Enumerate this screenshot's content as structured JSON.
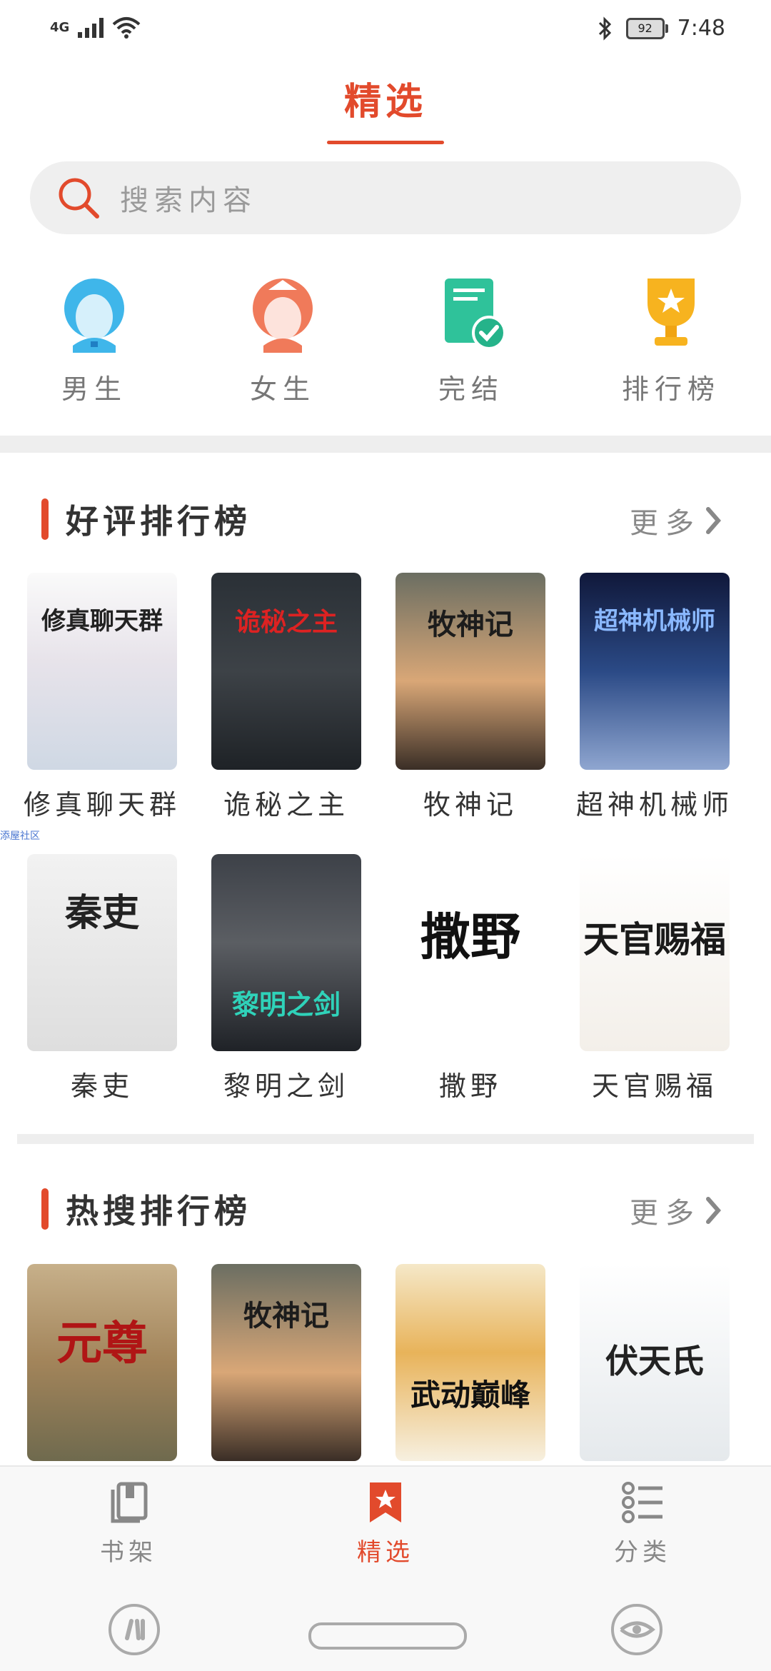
{
  "status": {
    "network": "4G",
    "battery": "92",
    "time": "7:48"
  },
  "header": {
    "title": "精选"
  },
  "search": {
    "placeholder": "搜索内容"
  },
  "quick": [
    {
      "label": "男生",
      "icon": "boy-avatar-icon"
    },
    {
      "label": "女生",
      "icon": "girl-avatar-icon"
    },
    {
      "label": "完结",
      "icon": "completed-book-icon"
    },
    {
      "label": "排行榜",
      "icon": "trophy-icon"
    }
  ],
  "section1": {
    "title": "好评排行榜",
    "more": "更多",
    "books": [
      {
        "title": "修真聊天群",
        "cover_text": "修真聊天群"
      },
      {
        "title": "诡秘之主",
        "cover_text": "诡秘之主"
      },
      {
        "title": "牧神记",
        "cover_text": "牧神记"
      },
      {
        "title": "超神机械师",
        "cover_text": "超神机械师"
      },
      {
        "title": "秦吏",
        "cover_text": "秦吏"
      },
      {
        "title": "黎明之剑",
        "cover_text": "黎明之剑"
      },
      {
        "title": "撒野",
        "cover_text": "撒野"
      },
      {
        "title": "天官赐福",
        "cover_text": "天官赐福"
      }
    ]
  },
  "watermark": "添屋社区",
  "section2": {
    "title": "热搜排行榜",
    "more": "更多",
    "books": [
      {
        "cover_text": "元尊"
      },
      {
        "cover_text": "牧神记"
      },
      {
        "cover_text": "武动巅峰"
      },
      {
        "cover_text": "伏天氏"
      }
    ]
  },
  "bottom_nav": [
    {
      "label": "书架",
      "icon": "bookshelf-icon",
      "active": false
    },
    {
      "label": "精选",
      "icon": "featured-bookmark-icon",
      "active": true
    },
    {
      "label": "分类",
      "icon": "category-list-icon",
      "active": false
    }
  ],
  "colors": {
    "accent": "#e24a2c",
    "muted": "#888888"
  }
}
